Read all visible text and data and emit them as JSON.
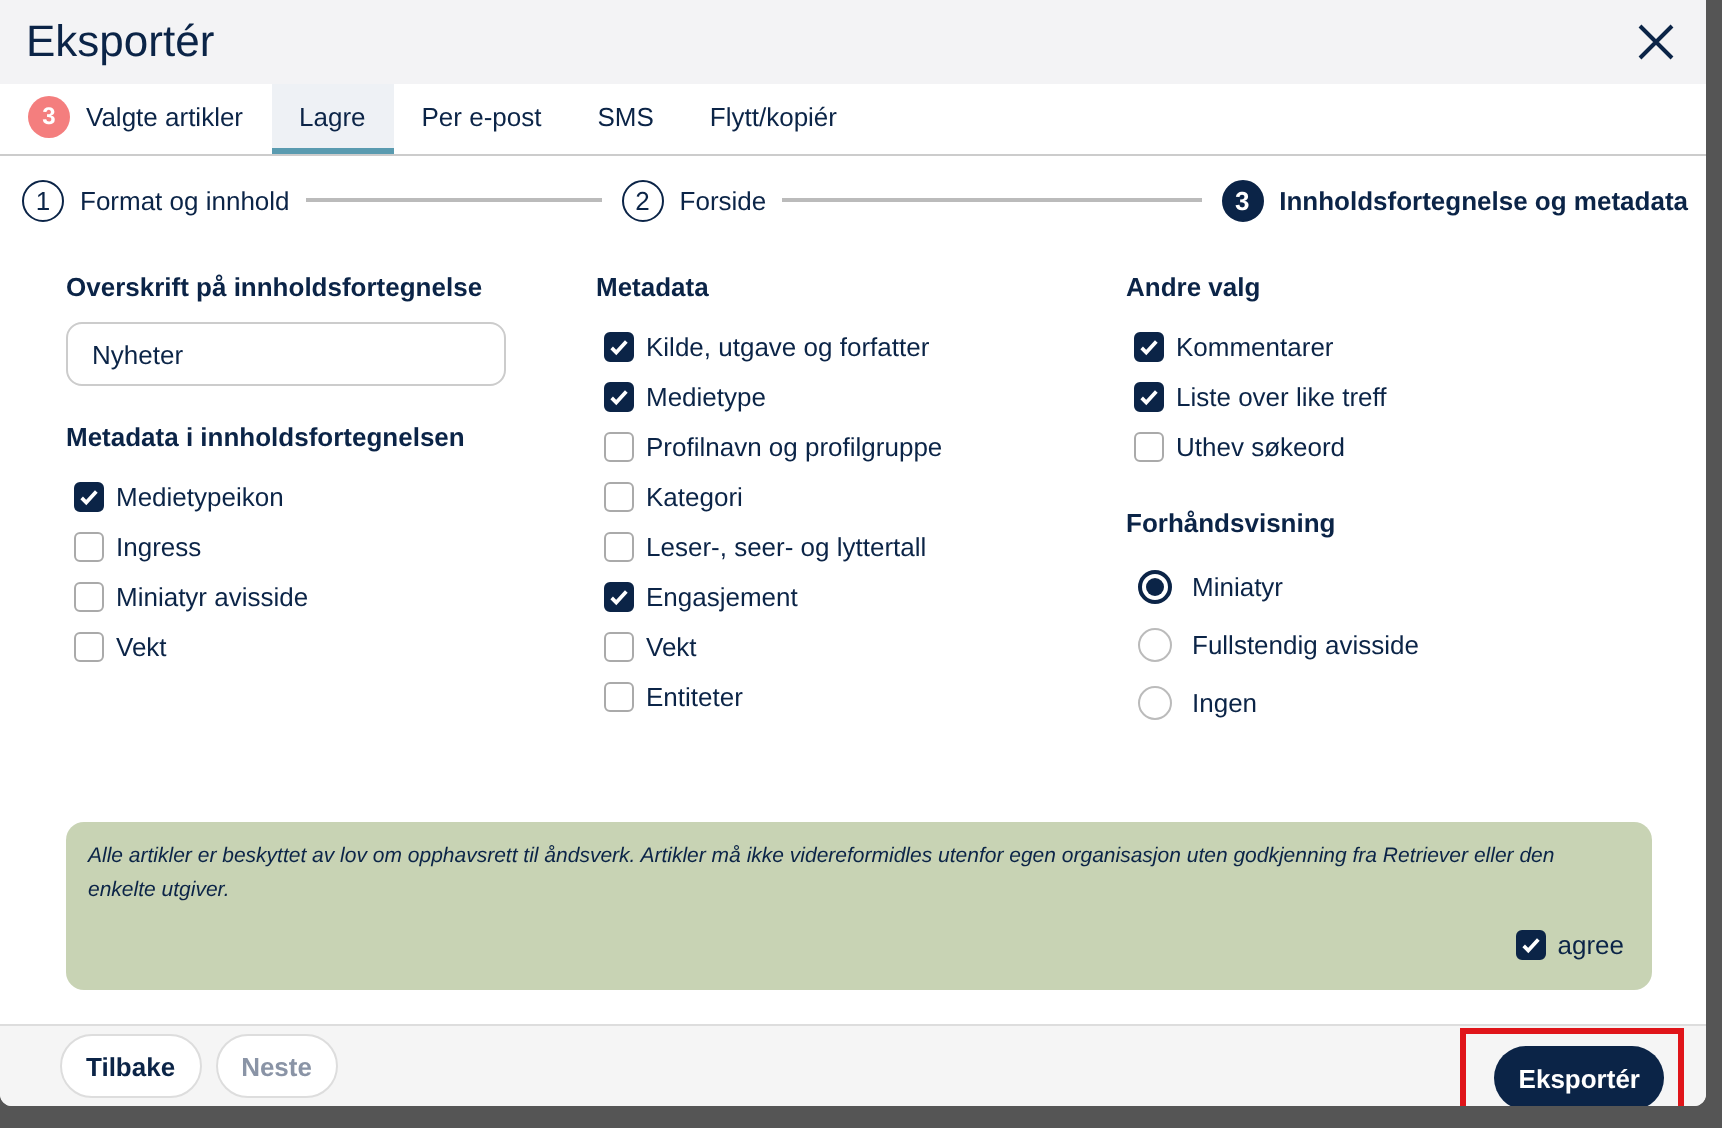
{
  "window": {
    "title": "Eksportér"
  },
  "tabs": [
    {
      "label": "Valgte artikler",
      "badge": "3",
      "selected": false
    },
    {
      "label": "Lagre",
      "selected": true
    },
    {
      "label": "Per e-post",
      "selected": false
    },
    {
      "label": "SMS",
      "selected": false
    },
    {
      "label": "Flytt/kopiér",
      "selected": false
    }
  ],
  "steps": [
    {
      "number": "1",
      "label": "Format og innhold",
      "selected": false
    },
    {
      "number": "2",
      "label": "Forside",
      "selected": false
    },
    {
      "number": "3",
      "label": "Innholdsfortegnelse og metadata",
      "selected": true
    }
  ],
  "columns": [
    {
      "sections": [
        {
          "heading": "Overskrift på innholdsfortegnelse",
          "kind": "field",
          "value": "Nyheter"
        },
        {
          "heading": "Metadata i innholdsfortegnelsen",
          "kind": "checkboxes",
          "items": [
            {
              "label": "Medietypeikon",
              "checked": true
            },
            {
              "label": "Ingress",
              "checked": false
            },
            {
              "label": "Miniatyr avisside",
              "checked": false
            },
            {
              "label": "Vekt",
              "checked": false
            }
          ]
        }
      ]
    },
    {
      "sections": [
        {
          "heading": "Metadata",
          "kind": "checkboxes",
          "items": [
            {
              "label": "Kilde, utgave og forfatter",
              "checked": true
            },
            {
              "label": "Medietype",
              "checked": true
            },
            {
              "label": "Profilnavn og profilgruppe",
              "checked": false
            },
            {
              "label": "Kategori",
              "checked": false
            },
            {
              "label": "Leser-, seer- og lyttertall",
              "checked": false
            },
            {
              "label": "Engasjement",
              "checked": true
            },
            {
              "label": "Vekt",
              "checked": false
            },
            {
              "label": "Entiteter",
              "checked": false
            }
          ]
        }
      ]
    },
    {
      "sections": [
        {
          "heading": "Andre valg",
          "kind": "checkboxes",
          "items": [
            {
              "label": "Kommentarer",
              "checked": true
            },
            {
              "label": "Liste over like treff",
              "checked": true
            },
            {
              "label": "Uthev søkeord",
              "checked": false
            }
          ]
        },
        {
          "heading": "Forhåndsvisning",
          "kind": "radios",
          "items": [
            {
              "label": "Miniatyr",
              "selected": true
            },
            {
              "label": "Fullstendig avisside",
              "selected": false
            },
            {
              "label": "Ingen",
              "selected": false
            }
          ]
        }
      ]
    }
  ],
  "notice": {
    "text": "Alle artikler er beskyttet av lov om opphavsrett til åndsverk. Artikler må ikke videreformidles utenfor egen organisasjon uten godkjenning fra Retriever eller den enkelte utgiver.",
    "agree": {
      "label": "agree",
      "checked": true
    }
  },
  "footer": {
    "buttons": [
      {
        "label": "Tilbake",
        "disabled": false
      },
      {
        "label": "Neste",
        "disabled": true
      }
    ],
    "export": {
      "label": "Eksportér",
      "highlighted": true
    }
  }
}
